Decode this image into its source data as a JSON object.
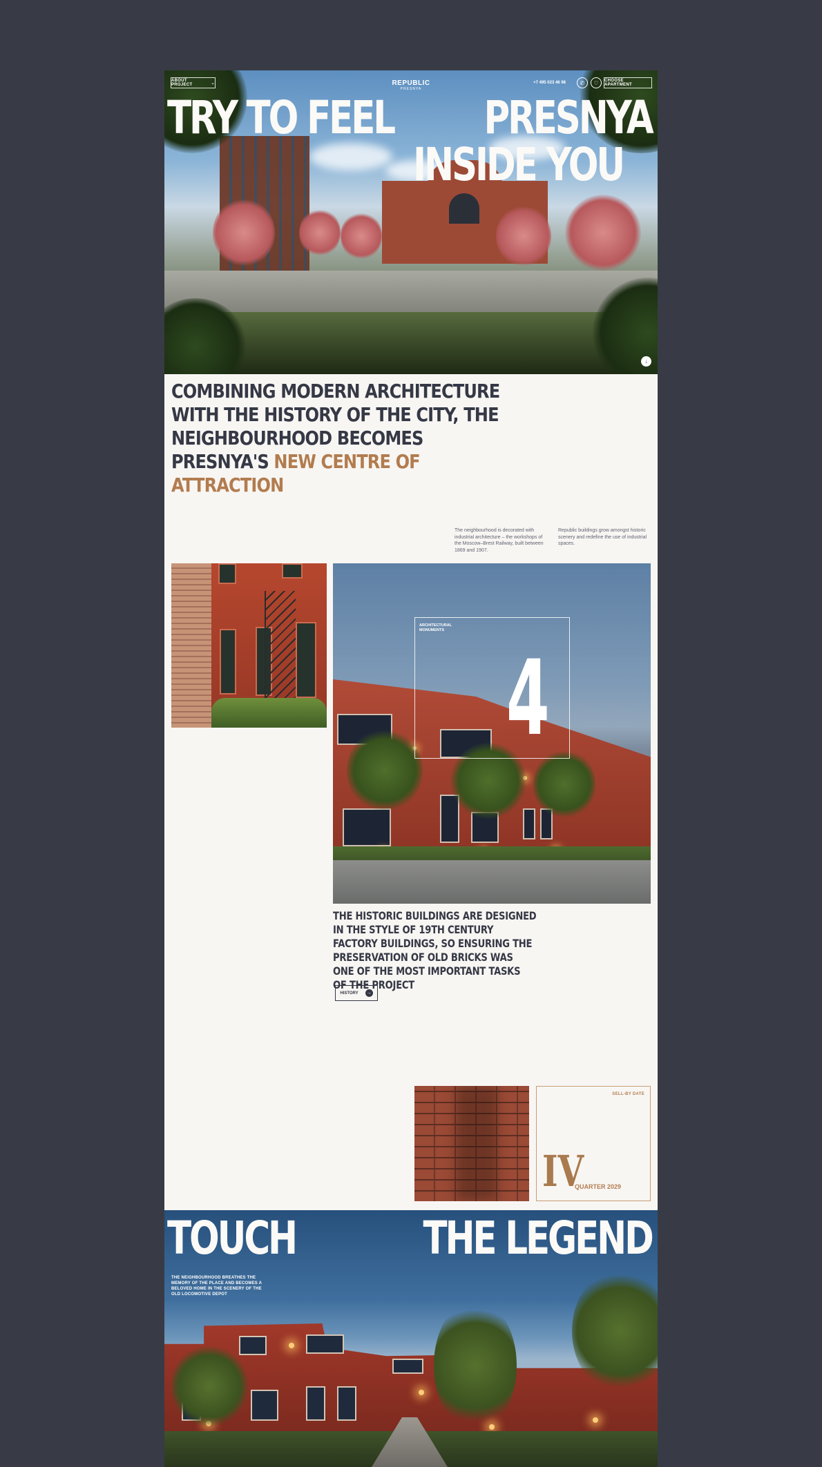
{
  "header": {
    "about_label": "ABOUT PROJECT",
    "logo_name": "REPUBLIC",
    "logo_sub": "PRESNYA",
    "phone": "+7 495 023 46 98",
    "choose_label": "CHOOSE APARTMENT",
    "icons": [
      "chevron-down-icon",
      "phone-icon",
      "heart-icon",
      "arrow-down-icon"
    ]
  },
  "hero": {
    "title_left": "TRY TO FEEL",
    "title_right_1": "PRESNYA",
    "title_right_2": "INSIDE YOU"
  },
  "intro": {
    "text": "COMBINING MODERN ARCHITECTURE WITH THE HISTORY OF THE CITY, THE NEIGHBOURHOOD BECOMES PRESNYA'S ",
    "accent": "NEW CENTRE OF ATTRACTION",
    "note_1": "The neighbourhood is decorated with industrial architecture – the workshops of the Moscow–Brest Railway, built between 1869 and 1907.",
    "note_2": "Republic buildings grow amongst historic scenery and redefine the use of industrial spaces."
  },
  "monuments": {
    "label": "ARCHITECTURAL MONUMENTS",
    "count": "4"
  },
  "history": {
    "text": "THE HISTORIC BUILDINGS ARE DESIGNED IN THE STYLE OF 19TH CENTURY FACTORY BUILDINGS, SO ENSURING THE PRESERVATION OF OLD BRICKS WAS ONE OF THE MOST IMPORTANT TASKS OF THE PROJECT",
    "button_label": "HISTORY"
  },
  "sell_by": {
    "label": "SELL-BY DATE",
    "numeral": "IV",
    "quarter": "QUARTER 2029"
  },
  "legend": {
    "title_left": "TOUCH",
    "title_right": "THE LEGEND",
    "subtitle": "THE NEIGHBOURHOOD BREATHES THE MEMORY OF THE PLACE AND BECOMES A BELOVED HOME IN THE SCENERY OF THE OLD LOCOMOTIVE DEPOT"
  },
  "colors": {
    "background": "#383b45",
    "page": "#f8f6f3",
    "text_dark": "#353845",
    "accent": "#b27c4f"
  }
}
